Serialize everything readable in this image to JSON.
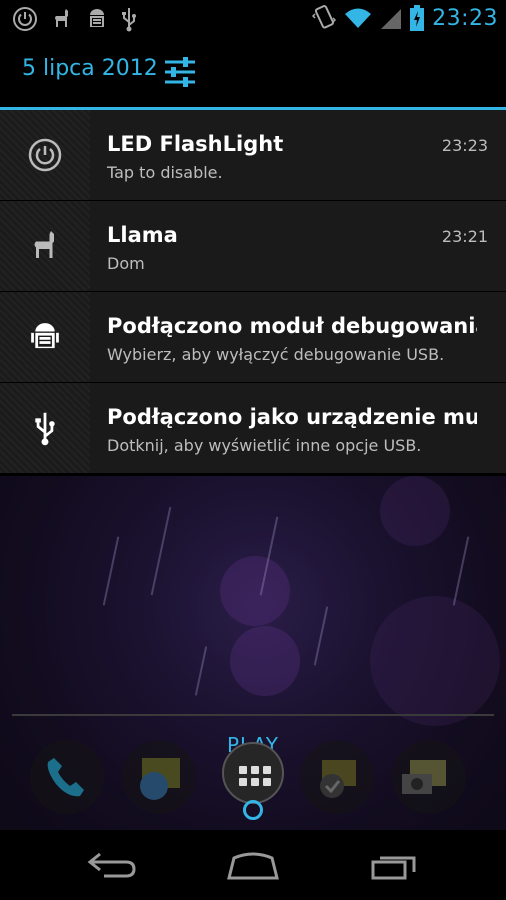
{
  "status_bar": {
    "icons_left": [
      "power-icon",
      "llama-icon",
      "android-debug-icon",
      "usb-icon"
    ],
    "icons_right": [
      "vibrate-icon",
      "wifi-icon",
      "signal-icon",
      "battery-charging-icon"
    ],
    "time": "23:23"
  },
  "header": {
    "date": "5 lipca 2012",
    "settings_icon": "settings-sliders-icon"
  },
  "notifications": [
    {
      "icon": "power-icon",
      "title": "LED FlashLight",
      "subtitle": "Tap to disable.",
      "time": "23:23"
    },
    {
      "icon": "llama-icon",
      "title": "Llama",
      "subtitle": "Dom",
      "time": "23:21"
    },
    {
      "icon": "android-debug-icon",
      "title": "Podłączono moduł debugowania U..",
      "subtitle": "Wybierz, aby wyłączyć debugowanie USB.",
      "time": ""
    },
    {
      "icon": "usb-icon",
      "title": "Podłączono jako urządzenie multi..",
      "subtitle": "Dotknij, aby wyświetlić inne opcje USB.",
      "time": ""
    }
  ],
  "dock": {
    "label": "PLAY",
    "icons": [
      "phone-icon",
      "people-icon",
      "app-drawer-icon",
      "messaging-icon",
      "camera-icon"
    ]
  },
  "navbar": {
    "icons": [
      "back-icon",
      "home-icon",
      "recent-apps-icon"
    ]
  },
  "colors": {
    "accent": "#33b5e5",
    "notification_bg": "#1a1a1a"
  }
}
